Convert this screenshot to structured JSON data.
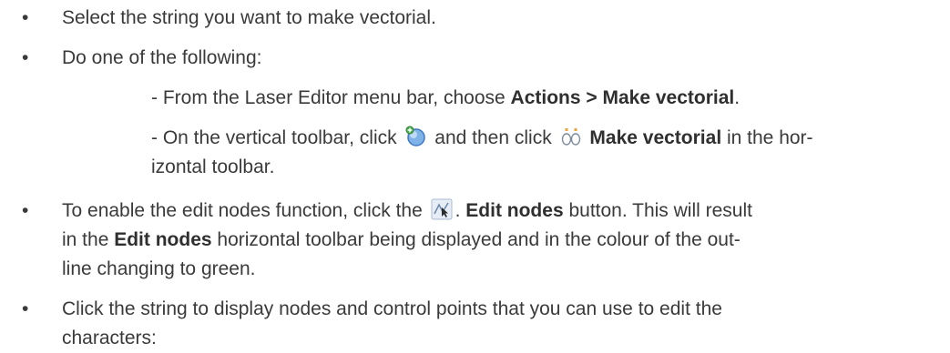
{
  "bullets": [
    {
      "text": "Select the string you want to make vectorial."
    },
    {
      "text": "Do one of the following:"
    },
    {
      "pre": "To enable the edit nodes function, click the",
      "icon": "edit-nodes-icon",
      "mid1": ". ",
      "bold1": "Edit nodes",
      "mid2": " button. This will result",
      "line2_pre": "in the ",
      "bold2": "Edit nodes",
      "line2_post": " horizontal toolbar being displayed and in the colour of the out-",
      "line3": "line changing to green."
    },
    {
      "line1": "Click the string to display nodes and control points that you can use to edit the",
      "line2": "characters:"
    }
  ],
  "sub_items": [
    {
      "pre": "- From the Laser Editor menu bar, choose ",
      "bold": "Actions > Make vectorial",
      "post": "."
    },
    {
      "pre": "- On the vertical toolbar, click",
      "icon1": "text-tool-icon",
      "mid": "and then click",
      "icon2": "make-vectorial-icon",
      "bold": "Make vectorial",
      "post": " in the hor-",
      "line2": "izontal toolbar."
    }
  ],
  "bullet_glyph": "•"
}
